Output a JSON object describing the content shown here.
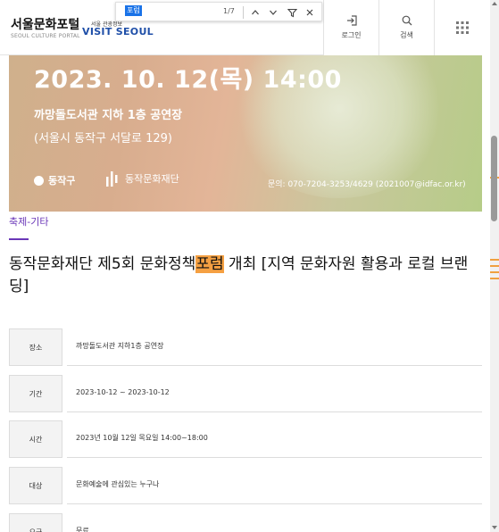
{
  "header": {
    "logo_main": "서울문화포털",
    "logo_sub": "SEOUL CULTURE PORTAL",
    "visit_small": "서울 관광정보",
    "visit_main": "VISIT SEOUL",
    "login_label": "로그인",
    "search_label": "검색"
  },
  "findbar": {
    "query": "포럼",
    "count": "1/7"
  },
  "banner": {
    "date_line": "2023. 10. 12(목) 14:00",
    "venue": "까망돌도서관 지하 1층 공연장",
    "address": "(서울시 동작구 서달로 129)",
    "org1": "동작구",
    "org2": "동작문화재단",
    "contact": "문의: 070-7204-3253/4629 (2021007@idfac.or.kr)"
  },
  "category": "축제-기타",
  "title": {
    "before": "동작문화재단 제5회 문화정책",
    "highlight": "포럼",
    "after": " 개최 [지역 문화자원 활용과 로컬 브랜딩]"
  },
  "info": [
    {
      "label": "장소",
      "value": "까망돌도서관 지하1층 공연장"
    },
    {
      "label": "기간",
      "value": "2023-10-12 ~ 2023-10-12"
    },
    {
      "label": "시간",
      "value": "2023년 10월 12일 목요일 14:00~18:00"
    },
    {
      "label": "대상",
      "value": "문화예술에 관심있는 누구나"
    },
    {
      "label": "요금",
      "value": "무료"
    }
  ],
  "colors": {
    "accent": "#6a37b8",
    "highlight": "#f5a042",
    "brand_blue": "#1f4fa8"
  }
}
